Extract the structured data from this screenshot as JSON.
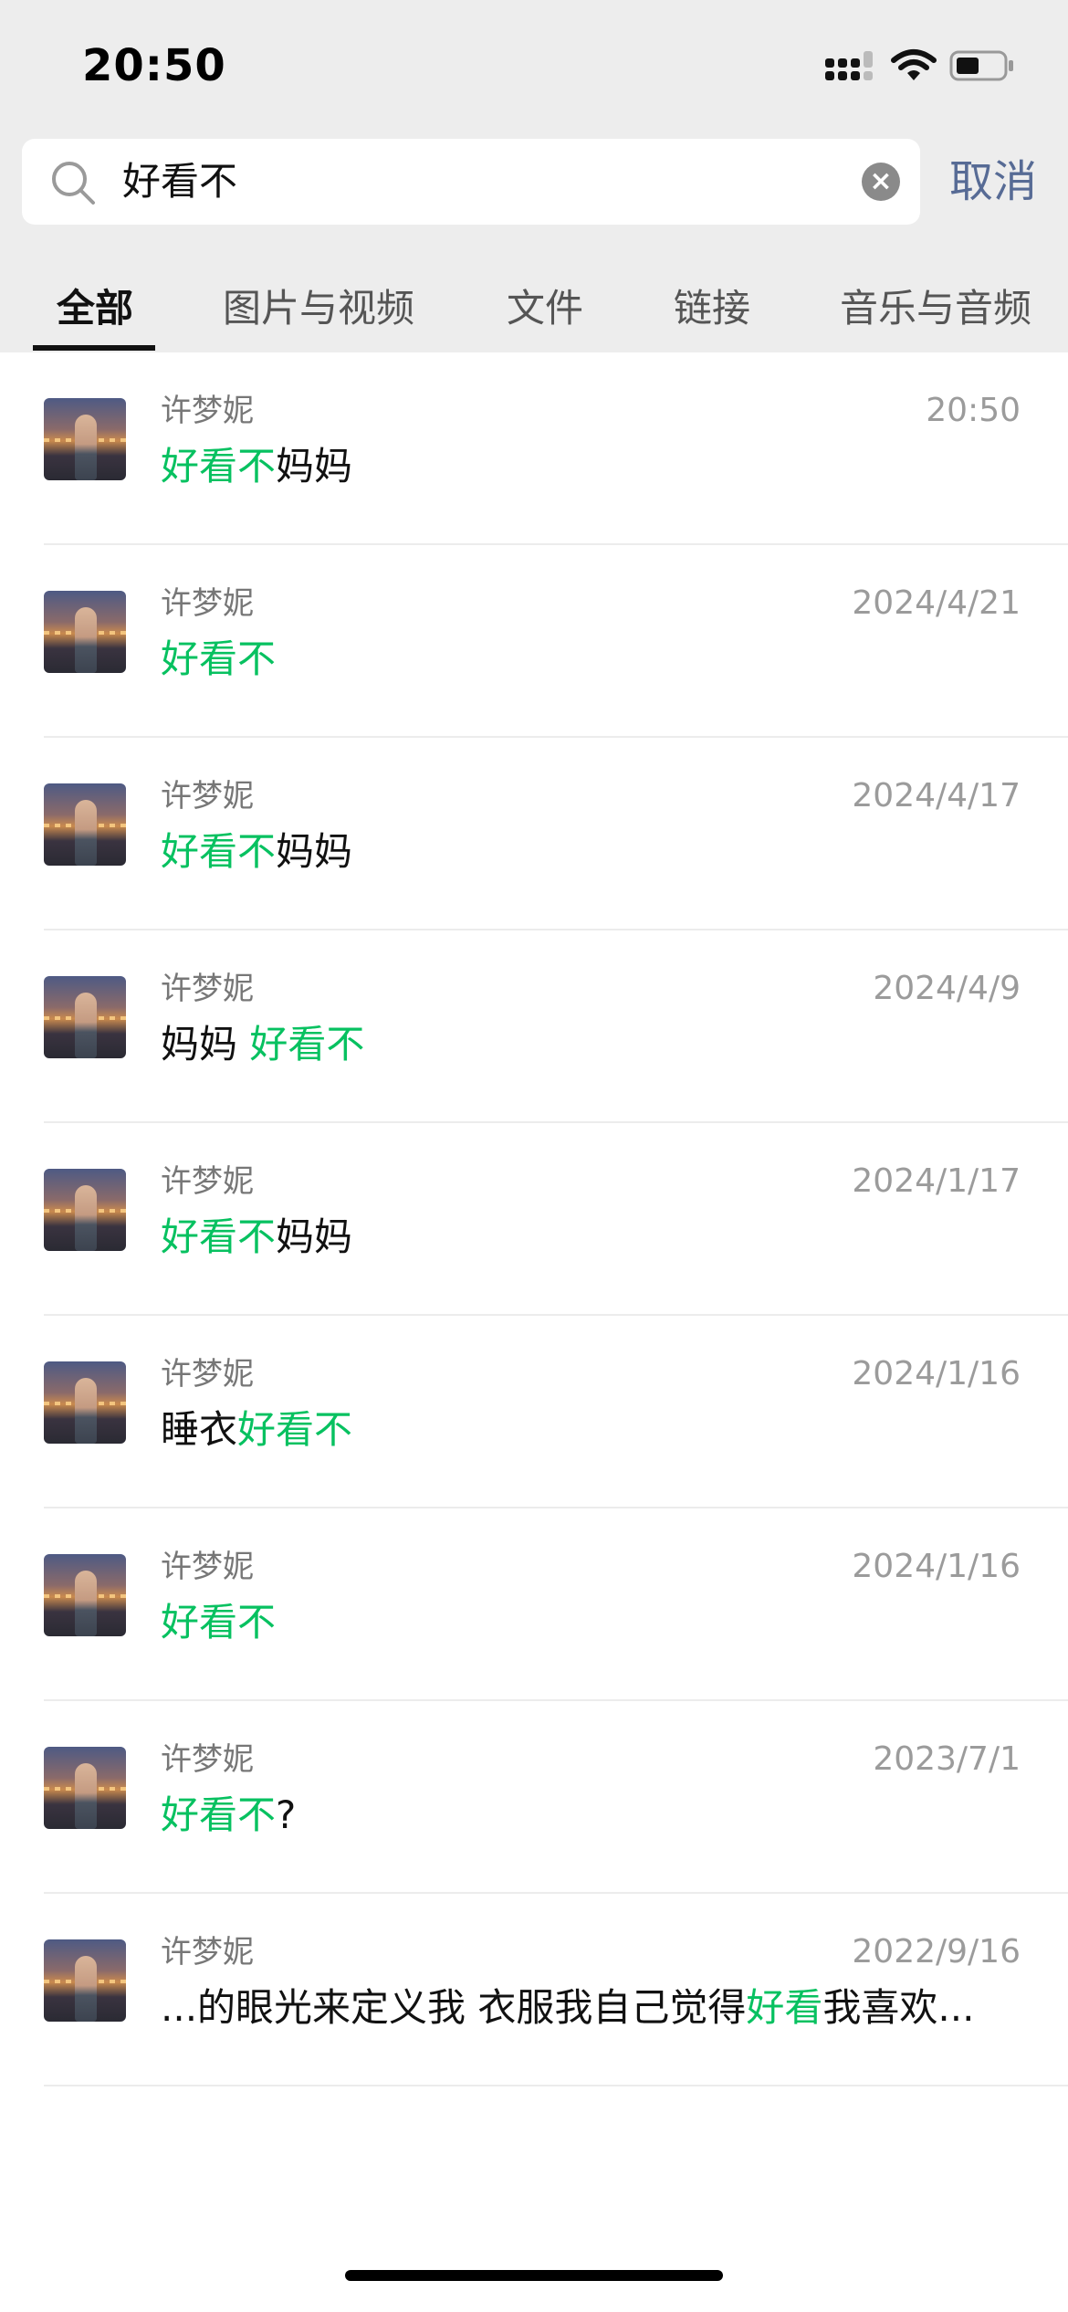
{
  "status_bar": {
    "time": "20:50"
  },
  "search": {
    "query": "好看不",
    "cancel_label": "取消"
  },
  "tabs": [
    {
      "label": "全部",
      "active": true
    },
    {
      "label": "图片与视频",
      "active": false
    },
    {
      "label": "文件",
      "active": false
    },
    {
      "label": "链接",
      "active": false
    },
    {
      "label": "音乐与音频",
      "active": false
    }
  ],
  "colors": {
    "highlight": "#07c160",
    "cancel": "#576b95"
  },
  "results": [
    {
      "name": "许梦妮",
      "date": "20:50",
      "segments": [
        {
          "t": "好看不",
          "h": true
        },
        {
          "t": "妈妈",
          "h": false
        }
      ]
    },
    {
      "name": "许梦妮",
      "date": "2024/4/21",
      "segments": [
        {
          "t": "好看不",
          "h": true
        }
      ]
    },
    {
      "name": "许梦妮",
      "date": "2024/4/17",
      "segments": [
        {
          "t": "好看不",
          "h": true
        },
        {
          "t": "妈妈",
          "h": false
        }
      ]
    },
    {
      "name": "许梦妮",
      "date": "2024/4/9",
      "segments": [
        {
          "t": "妈妈 ",
          "h": false
        },
        {
          "t": "好看不",
          "h": true
        }
      ]
    },
    {
      "name": "许梦妮",
      "date": "2024/1/17",
      "segments": [
        {
          "t": "好看不",
          "h": true
        },
        {
          "t": "妈妈",
          "h": false
        }
      ]
    },
    {
      "name": "许梦妮",
      "date": "2024/1/16",
      "segments": [
        {
          "t": "睡衣",
          "h": false
        },
        {
          "t": "好看不",
          "h": true
        }
      ]
    },
    {
      "name": "许梦妮",
      "date": "2024/1/16",
      "segments": [
        {
          "t": "好看不",
          "h": true
        }
      ]
    },
    {
      "name": "许梦妮",
      "date": "2023/7/1",
      "segments": [
        {
          "t": "好看不",
          "h": true
        },
        {
          "t": "?",
          "h": false
        }
      ]
    },
    {
      "name": "许梦妮",
      "date": "2022/9/16",
      "segments": [
        {
          "t": "...的眼光来定义我 衣服我自己觉得",
          "h": false
        },
        {
          "t": "好看",
          "h": true
        },
        {
          "t": "我喜欢...",
          "h": false
        }
      ]
    }
  ]
}
